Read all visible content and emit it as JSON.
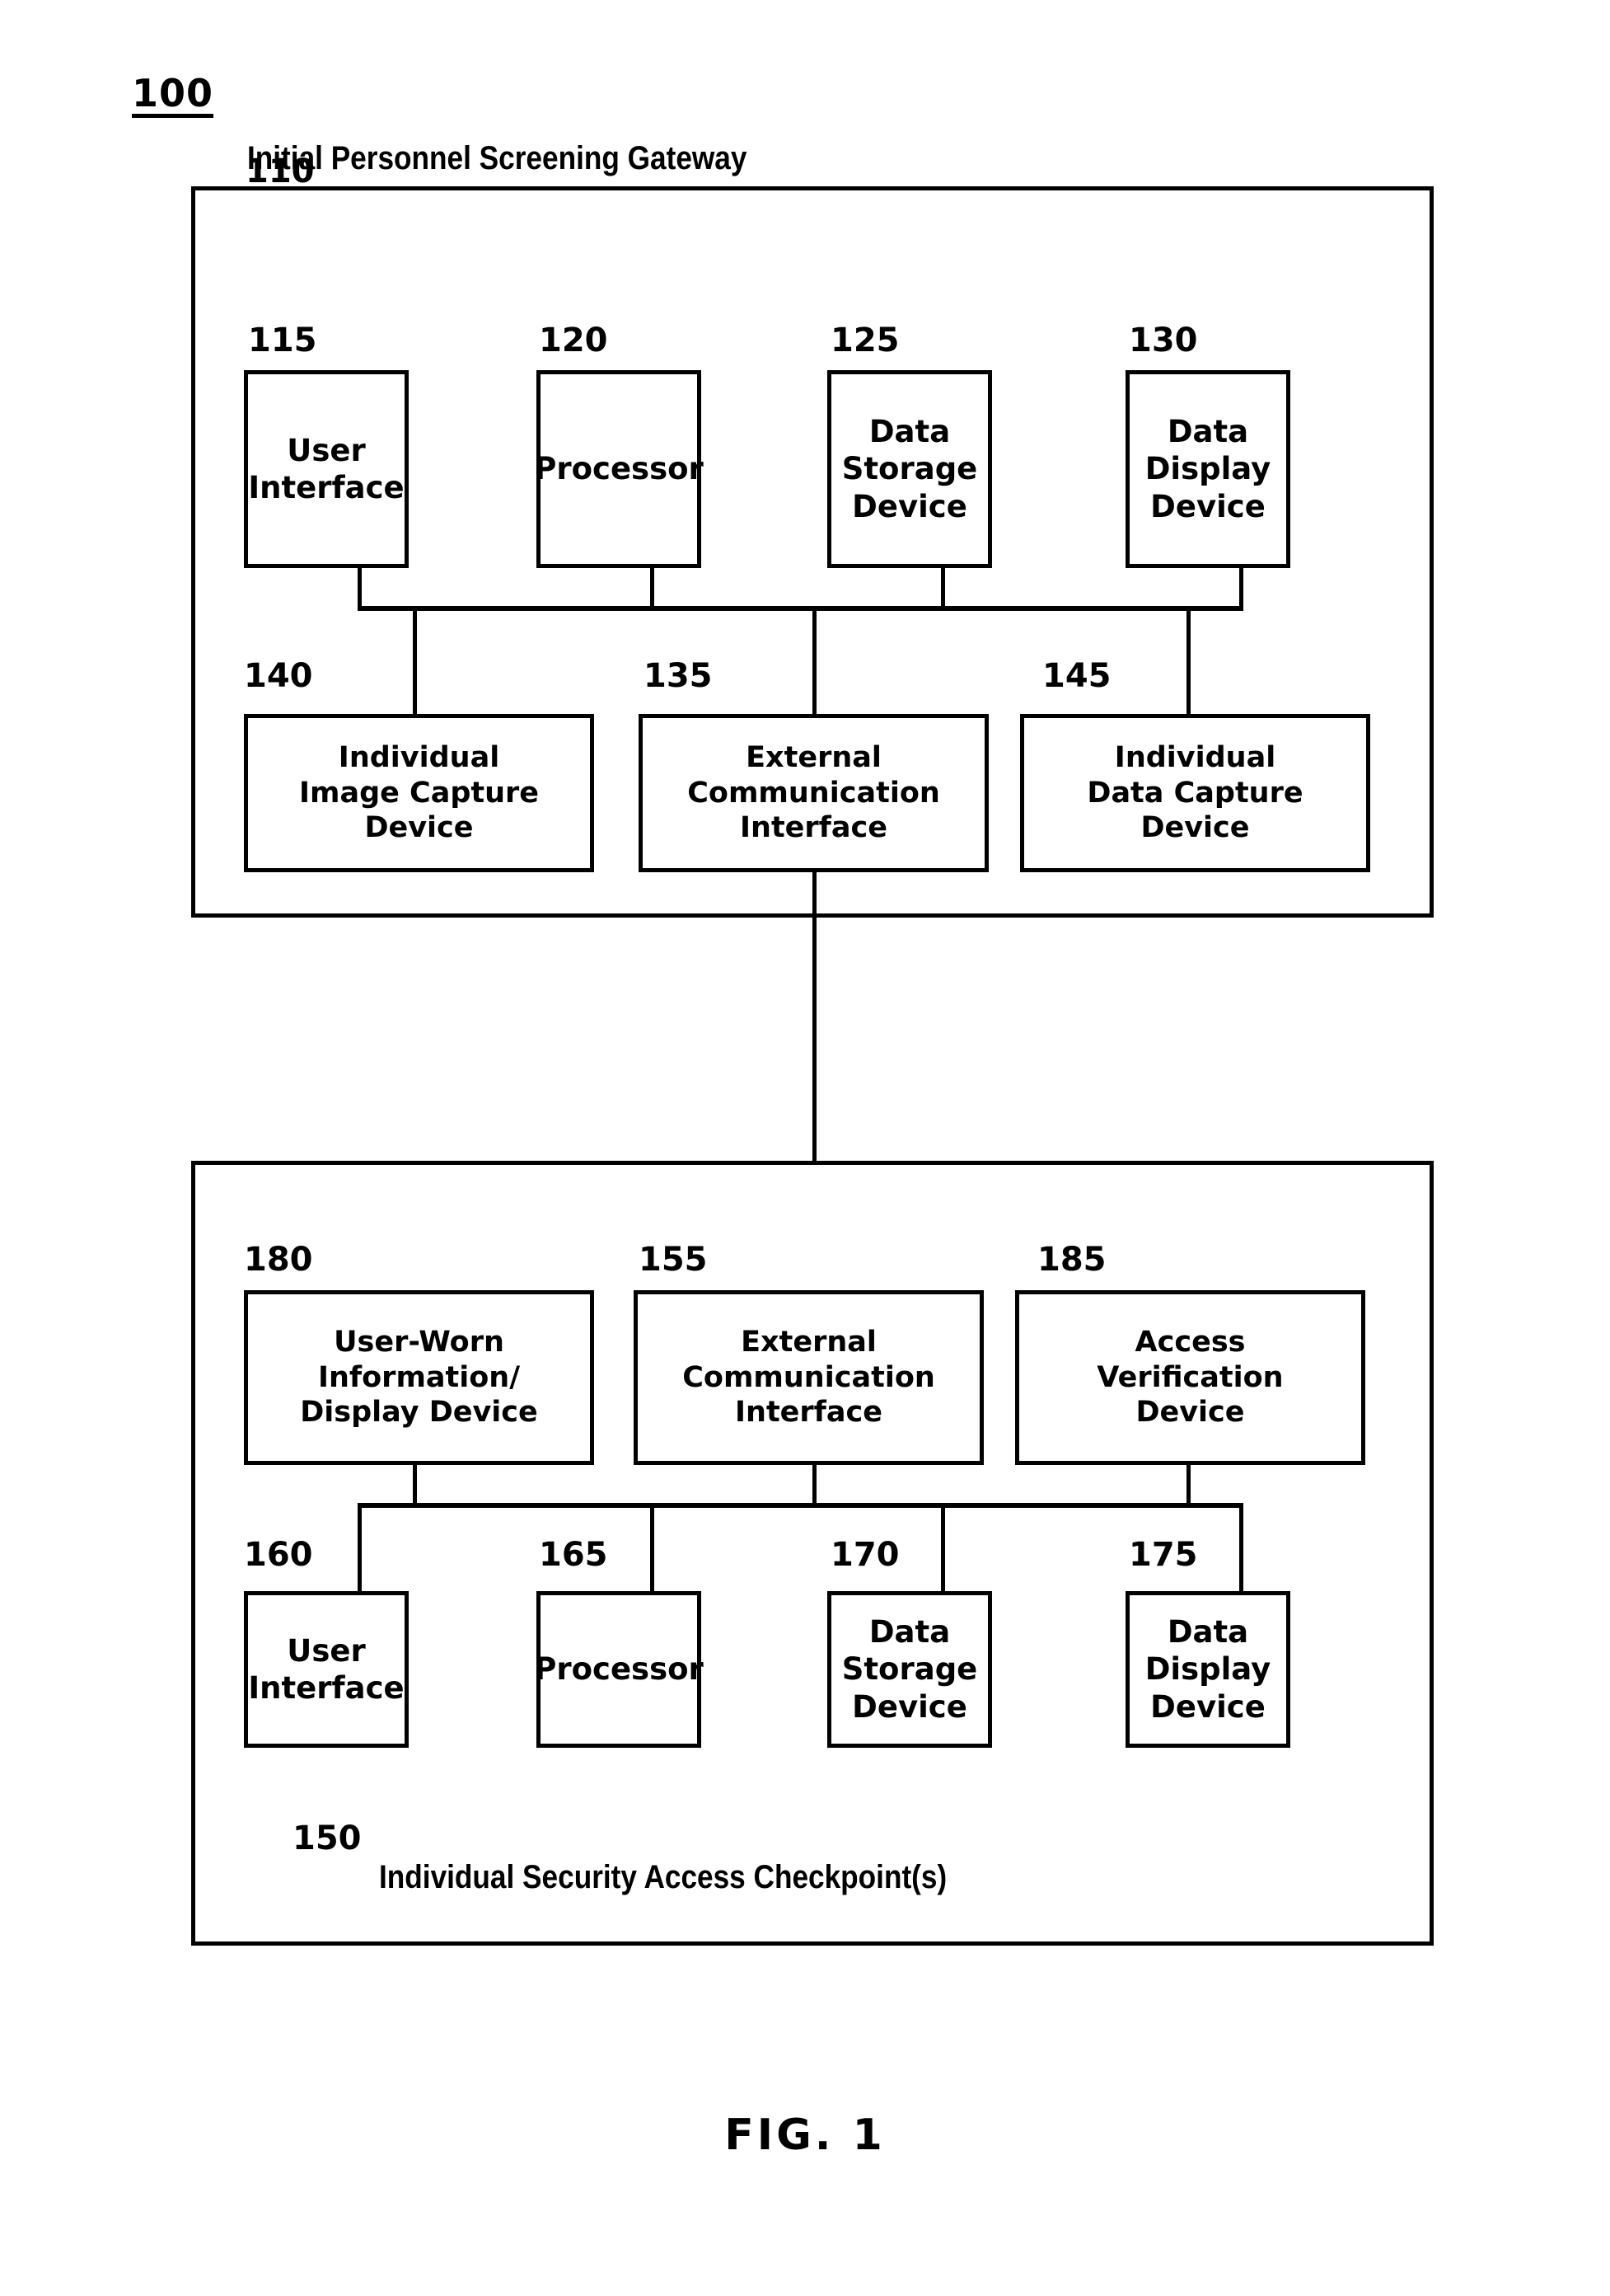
{
  "figure": {
    "system_ref": "100",
    "caption": "FIG. 1"
  },
  "gateway": {
    "ref": "110",
    "title": "Initial Personnel Screening Gateway",
    "top_row": [
      {
        "ref": "115",
        "label": "User\nInterface"
      },
      {
        "ref": "120",
        "label": "Processor"
      },
      {
        "ref": "125",
        "label": "Data\nStorage\nDevice"
      },
      {
        "ref": "130",
        "label": "Data\nDisplay\nDevice"
      }
    ],
    "bottom_row": [
      {
        "ref": "140",
        "label": "Individual\nImage Capture\nDevice"
      },
      {
        "ref": "135",
        "label": "External\nCommunication\nInterface"
      },
      {
        "ref": "145",
        "label": "Individual\nData Capture\nDevice"
      }
    ]
  },
  "checkpoint": {
    "ref": "150",
    "title": "Individual Security Access Checkpoint(s)",
    "top_row": [
      {
        "ref": "180",
        "label": "User-Worn\nInformation/\nDisplay Device"
      },
      {
        "ref": "155",
        "label": "External\nCommunication\nInterface"
      },
      {
        "ref": "185",
        "label": "Access\nVerification\nDevice"
      }
    ],
    "bottom_row": [
      {
        "ref": "160",
        "label": "User\nInterface"
      },
      {
        "ref": "165",
        "label": "Processor"
      },
      {
        "ref": "170",
        "label": "Data\nStorage\nDevice"
      },
      {
        "ref": "175",
        "label": "Data\nDisplay\nDevice"
      }
    ]
  },
  "colors": {
    "stroke": "#000000",
    "background": "#ffffff"
  }
}
